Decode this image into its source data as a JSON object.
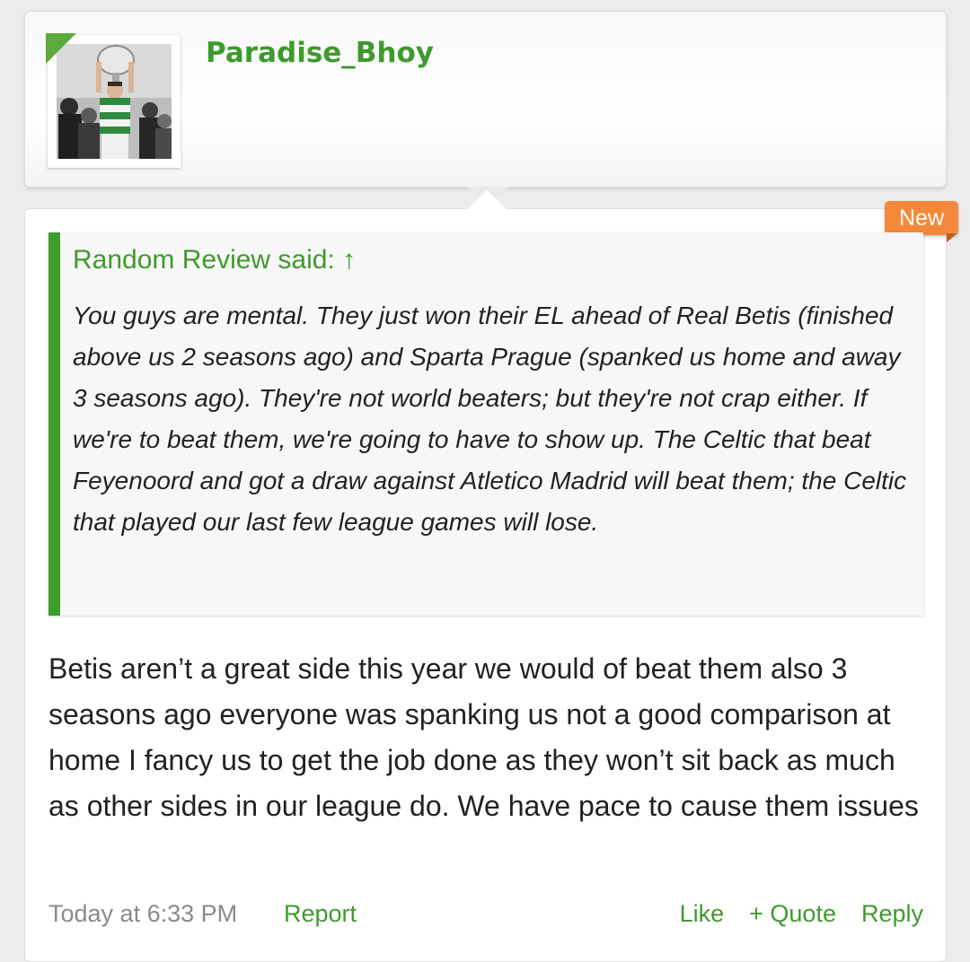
{
  "author": {
    "username": "Paradise_Bhoy",
    "avatar": "avatar-photo"
  },
  "badge": {
    "label": "New"
  },
  "quote": {
    "attribution": "Random Review said: ↑",
    "text": "You guys are mental. They just won their EL ahead of Real Betis (finished above us 2 seasons ago) and Sparta Prague (spanked us home and away 3 seasons ago). They're not world beaters; but they're not crap either. If we're to beat them, we're going to have to show up. The Celtic that beat Feyenoord and got a draw against Atletico Madrid will beat them; the Celtic that played our last few league games will lose."
  },
  "message": {
    "text": "Betis aren’t a great side this year we would of beat them also 3 seasons ago everyone was spanking us not a good comparison at home I fancy us to get the job done as they won’t sit back as much as other sides in our league do. We have pace to cause them issues"
  },
  "footer": {
    "timestamp": "Today at 6:33 PM",
    "report": "Report",
    "like": "Like",
    "quote": "+ Quote",
    "reply": "Reply"
  },
  "colors": {
    "accent_green": "#3f9a2c",
    "badge_orange": "#f5883a",
    "timestamp_gray": "#8a8a8a"
  }
}
